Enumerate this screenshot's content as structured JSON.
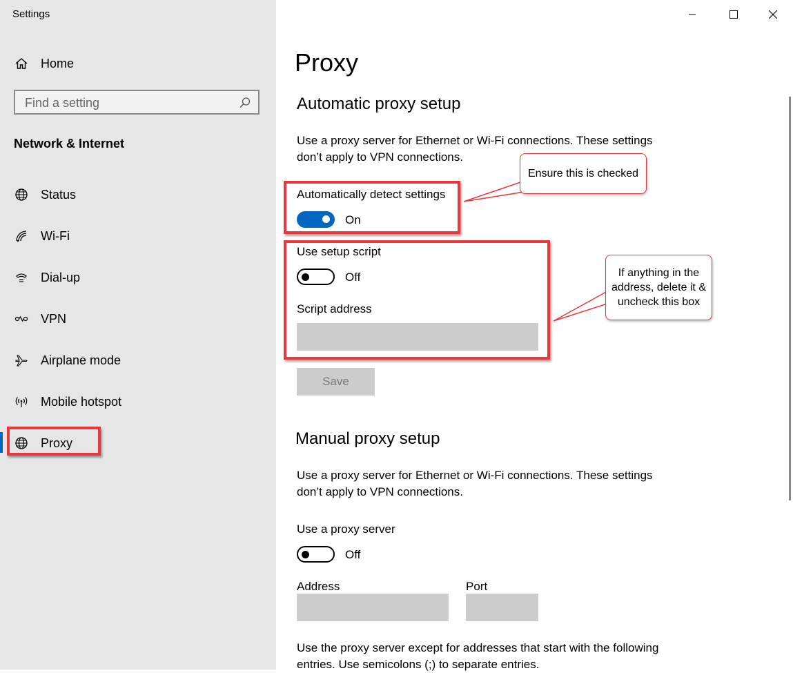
{
  "window": {
    "title": "Settings"
  },
  "sidebar": {
    "home_label": "Home",
    "search_placeholder": "Find a setting",
    "group_heading": "Network & Internet",
    "items": [
      {
        "label": "Status",
        "icon": "globe-status-icon"
      },
      {
        "label": "Wi-Fi",
        "icon": "wifi-icon"
      },
      {
        "label": "Dial-up",
        "icon": "dialup-icon"
      },
      {
        "label": "VPN",
        "icon": "vpn-icon"
      },
      {
        "label": "Airplane mode",
        "icon": "airplane-icon"
      },
      {
        "label": "Mobile hotspot",
        "icon": "hotspot-icon"
      },
      {
        "label": "Proxy",
        "icon": "globe-icon",
        "active": true
      }
    ]
  },
  "main": {
    "page_title": "Proxy",
    "automatic": {
      "heading": "Automatic proxy setup",
      "description": "Use a proxy server for Ethernet or Wi-Fi connections. These settings don’t apply to VPN connections.",
      "auto_detect_label": "Automatically detect settings",
      "auto_detect_state": "On",
      "setup_script_label": "Use setup script",
      "setup_script_state": "Off",
      "script_address_label": "Script address",
      "script_address_value": "",
      "save_label": "Save"
    },
    "manual": {
      "heading": "Manual proxy setup",
      "description": "Use a proxy server for Ethernet or Wi-Fi connections. These settings don’t apply to VPN connections.",
      "use_proxy_label": "Use a proxy server",
      "use_proxy_state": "Off",
      "address_label": "Address",
      "address_value": "",
      "port_label": "Port",
      "port_value": "",
      "exceptions_text": "Use the proxy server except for addresses that start with the following entries. Use semicolons (;) to separate entries."
    }
  },
  "annotations": {
    "callout_1": "Ensure this is checked",
    "callout_2": "If anything in the address, delete it & uncheck this box"
  },
  "colors": {
    "accent": "#0067c0",
    "annotation_red": "#e8383d",
    "sidebar_bg": "#e6e6e6",
    "field_bg": "#cccccc"
  }
}
